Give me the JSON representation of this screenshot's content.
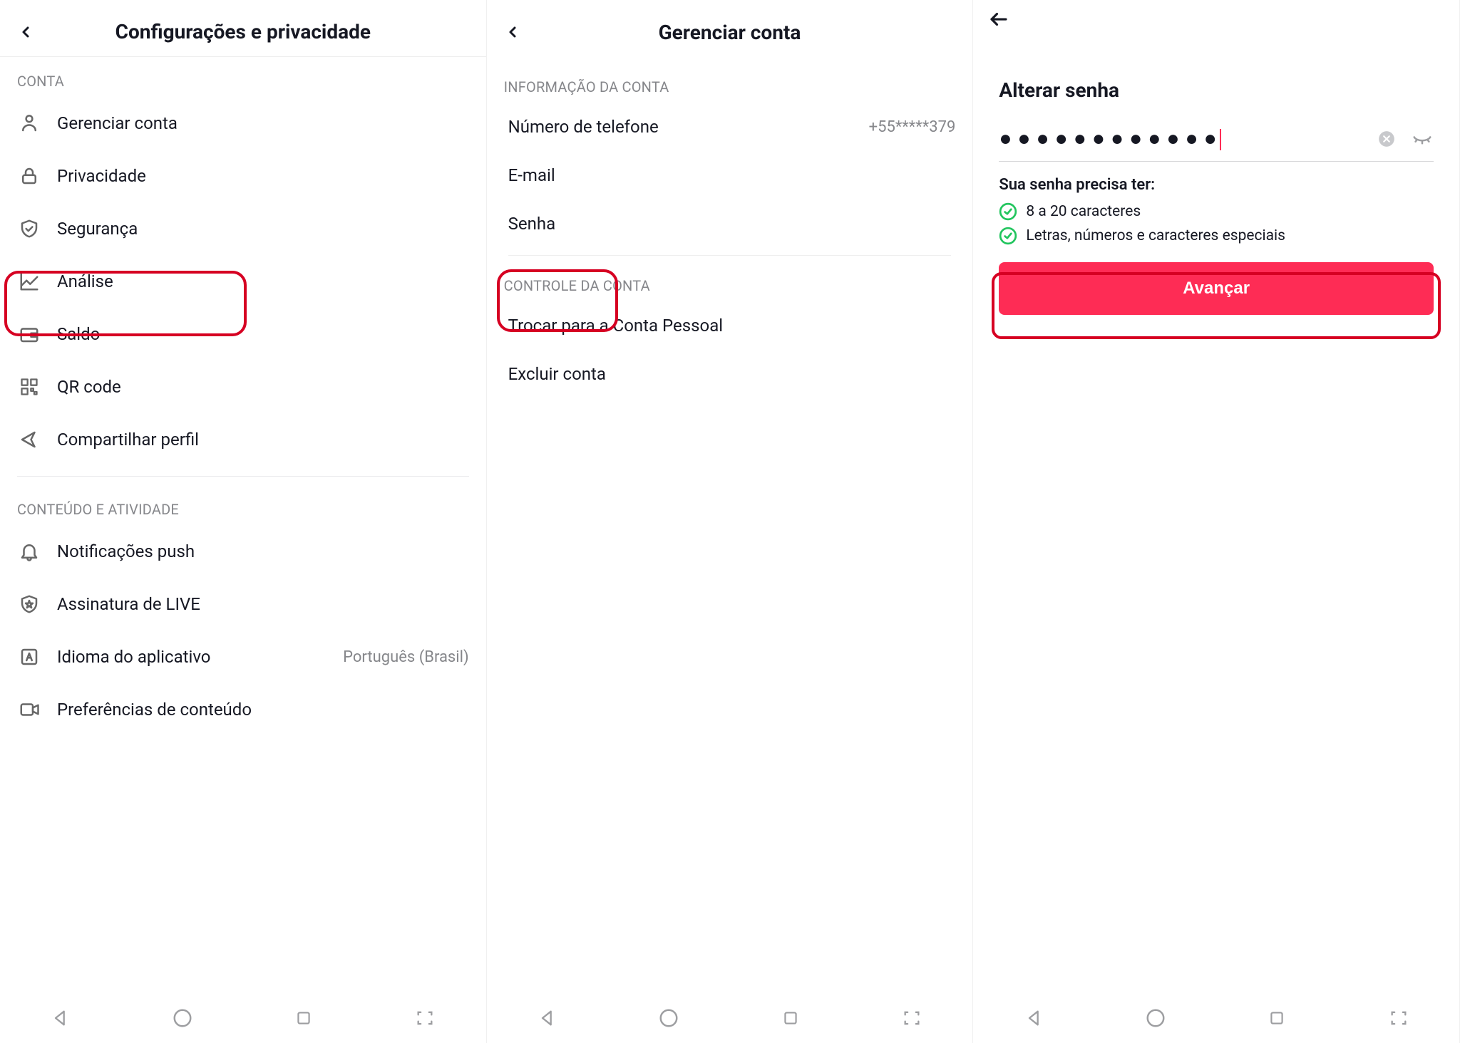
{
  "panel1": {
    "title": "Configurações e privacidade",
    "section_account": "CONTA",
    "items_account": [
      {
        "label": "Gerenciar conta"
      },
      {
        "label": "Privacidade"
      },
      {
        "label": "Segurança"
      },
      {
        "label": "Análise"
      },
      {
        "label": "Saldo"
      },
      {
        "label": "QR code"
      },
      {
        "label": "Compartilhar perfil"
      }
    ],
    "section_content": "CONTEÚDO E ATIVIDADE",
    "items_content": [
      {
        "label": "Notificações push"
      },
      {
        "label": "Assinatura de LIVE"
      },
      {
        "label": "Idioma do aplicativo",
        "value": "Português (Brasil)"
      },
      {
        "label": "Preferências de conteúdo"
      }
    ]
  },
  "panel2": {
    "title": "Gerenciar conta",
    "section_info": "INFORMAÇÃO DA CONTA",
    "items_info": [
      {
        "label": "Número de telefone",
        "value": "+55*****379"
      },
      {
        "label": "E-mail"
      },
      {
        "label": "Senha"
      }
    ],
    "section_control": "CONTROLE DA CONTA",
    "items_control": [
      {
        "label": "Trocar para a Conta Pessoal"
      },
      {
        "label": "Excluir conta"
      }
    ]
  },
  "panel3": {
    "title": "Alterar senha",
    "password_masked": "●●●●●●●●●●●●",
    "requirements_title": "Sua senha precisa ter:",
    "requirements": [
      "8 a 20 caracteres",
      "Letras, números e caracteres especiais"
    ],
    "submit_label": "Avançar"
  }
}
